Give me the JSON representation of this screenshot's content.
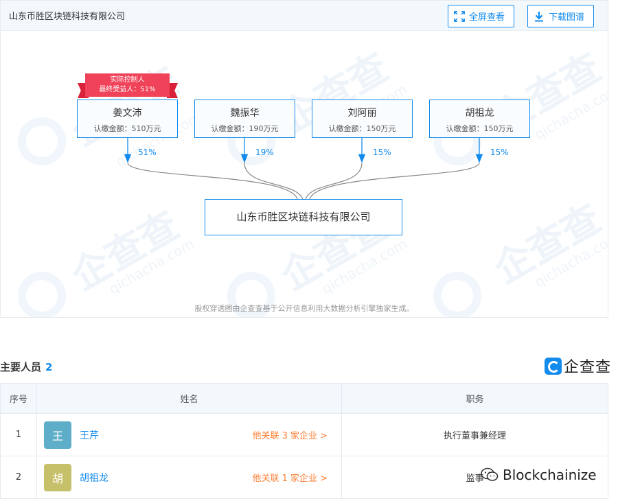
{
  "panel": {
    "title": "山东币胜区块链科技有限公司",
    "fullscreen_label": "全屏查看",
    "download_label": "下载图谱"
  },
  "watermark": {
    "brand_cn": "企查查",
    "brand_en": "qichacha.com"
  },
  "badge": {
    "line1": "实际控制人",
    "line2": "最终受益人：51%"
  },
  "shareholders": [
    {
      "name": "姜文沛",
      "amount": "认缴金额：510万元",
      "pct": "51%"
    },
    {
      "name": "魏振华",
      "amount": "认缴金额：190万元",
      "pct": "19%"
    },
    {
      "name": "刘阿丽",
      "amount": "认缴金额：150万元",
      "pct": "15%"
    },
    {
      "name": "胡祖龙",
      "amount": "认缴金额：150万元",
      "pct": "15%"
    }
  ],
  "company": {
    "name": "山东币胜区块链科技有限公司"
  },
  "footnote": "股权穿透图由企查查基于公开信息利用大数据分析引擎独家生成。",
  "staff": {
    "title": "主要人员",
    "count": "2",
    "brand": "企查查",
    "columns": {
      "index": "序号",
      "name": "姓名",
      "role": "职务"
    },
    "rows": [
      {
        "index": "1",
        "avatar": "王",
        "name": "王芹",
        "assoc": "他关联 3 家企业 >",
        "role": "执行董事兼经理",
        "avatar_color": "#5eaec9"
      },
      {
        "index": "2",
        "avatar": "胡",
        "name": "胡祖龙",
        "assoc": "他关联 1 家企业 >",
        "role": "监事",
        "avatar_color": "#c7c06a"
      }
    ]
  },
  "wechat_watermark": "Blockchainize",
  "colors": {
    "accent": "#128bed",
    "link_orange": "#fd7e33",
    "badge_red": "#f04359"
  }
}
